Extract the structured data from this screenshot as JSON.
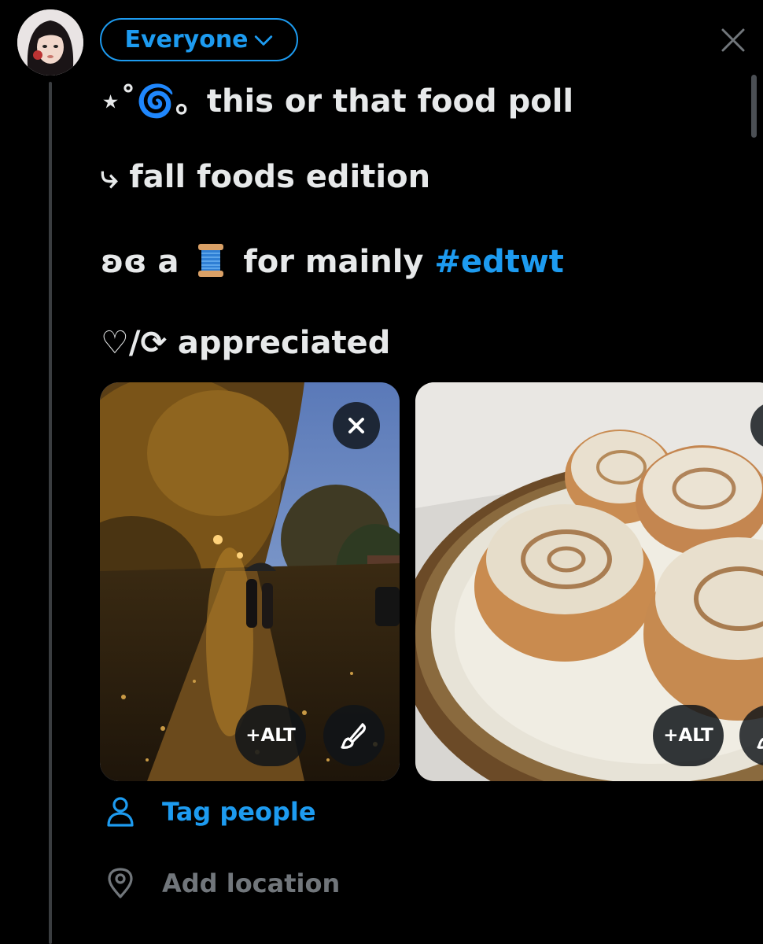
{
  "composer": {
    "audience_label": "Everyone",
    "close_icon": "close-icon"
  },
  "post": {
    "line1": "⋆˚🌀。this or that food poll",
    "line2": "⤷ fall foods edition",
    "line3_prefix": "ʚɞ  a",
    "line3_spool": "spool-of-thread-emoji",
    "line3_middle": " for mainly ",
    "line3_hashtag": "#edtwt",
    "line4": "♡/⟳ appreciated"
  },
  "media": [
    {
      "alt_label": "+ALT",
      "description_icon": "autumn-street-photo"
    },
    {
      "alt_label": "+ALT",
      "description_icon": "cinnamon-rolls-photo"
    }
  ],
  "options": {
    "tag_people": "Tag people",
    "add_location": "Add location"
  },
  "colors": {
    "accent": "#1d9bf0",
    "muted": "#71767b",
    "background": "#000000"
  }
}
